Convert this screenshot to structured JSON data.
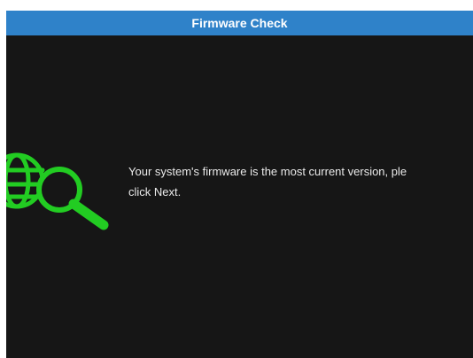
{
  "window": {
    "title": "Firmware Check"
  },
  "main": {
    "icon": "globe-magnifier-icon",
    "message_line1": "Your system's firmware is the most current version, ple",
    "message_line2": "click Next."
  },
  "colors": {
    "title_bar": "#2f82c9",
    "background": "#161616",
    "icon": "#22cc22",
    "text": "#eaeaea"
  }
}
